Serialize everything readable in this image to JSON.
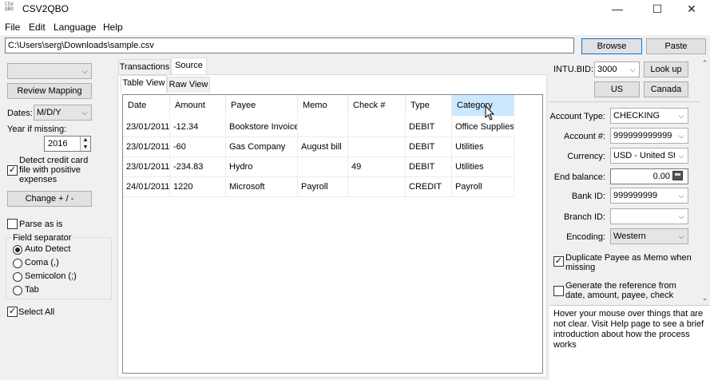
{
  "window": {
    "app_icon_text": "CSV QBO",
    "title": "CSV2QBO",
    "minimize": "—",
    "maximize": "☐",
    "close": "✕"
  },
  "menu": [
    "File",
    "Edit",
    "Language",
    "Help"
  ],
  "path": {
    "value": "C:\\Users\\serg\\Downloads\\sample.csv",
    "browse_label": "Browse",
    "paste_label": "Paste"
  },
  "left": {
    "mapping_select_value": "",
    "review_mapping_label": "Review Mapping",
    "dates_label": "Dates:",
    "dates_value": "M/D/Y",
    "year_missing_label": "Year if missing:",
    "year_value": "2016",
    "detect_cc_label_1": "Detect credit card",
    "detect_cc_label_2": "file with positive",
    "detect_cc_label_3": "expenses",
    "detect_cc_checked": "✓",
    "change_sign_label": "Change + / -",
    "parse_as_is_label": "Parse as is",
    "field_separator_label": "Field separator",
    "separators": [
      "Auto Detect",
      "Coma (,)",
      "Semicolon (;)",
      "Tab"
    ],
    "select_all_label": "Select All",
    "select_all_checked": "✓"
  },
  "tabs": {
    "top": [
      "Transactions",
      "Source"
    ],
    "sub": [
      "Table View",
      "Raw View"
    ]
  },
  "table": {
    "headers": [
      "Date",
      "Amount",
      "Payee",
      "Memo",
      "Check #",
      "Type",
      "Category"
    ],
    "rows": [
      [
        "23/01/2011",
        "-12.34",
        "Bookstore Invoice",
        "",
        "",
        "DEBIT",
        "Office Supplies"
      ],
      [
        "23/01/2011",
        "-60",
        "Gas Company",
        "August bill",
        "",
        "DEBIT",
        "Utilities"
      ],
      [
        "23/01/2011",
        "-234.83",
        "Hydro",
        "",
        "49",
        "DEBIT",
        "Utilities"
      ],
      [
        "24/01/2011",
        "1220",
        "Microsoft",
        "Payroll",
        "",
        "CREDIT",
        "Payroll"
      ]
    ]
  },
  "right": {
    "intu_bid_label": "INTU.BID:",
    "intu_bid_value": "3000",
    "lookup_label": "Look up",
    "us_label": "US",
    "canada_label": "Canada",
    "account_type_label": "Account Type:",
    "account_type_value": "CHECKING",
    "account_num_label": "Account #:",
    "account_num_value": "999999999999",
    "currency_label": "Currency:",
    "currency_value": "USD - United Sta",
    "end_balance_label": "End balance:",
    "end_balance_value": "0.00",
    "bank_id_label": "Bank ID:",
    "bank_id_value": "999999999",
    "branch_id_label": "Branch ID:",
    "branch_id_value": "",
    "encoding_label": "Encoding:",
    "encoding_value": "Western",
    "dup_payee_label_1": "Duplicate Payee as Memo when",
    "dup_payee_label_2": "missing",
    "dup_payee_checked": "✓",
    "gen_ref_label_1": "Generate the reference from",
    "gen_ref_label_2": "date, amount, payee, check",
    "help_text": "Hover your mouse over things that are not clear. Visit Help page to see a brief introduction about how the process works"
  }
}
